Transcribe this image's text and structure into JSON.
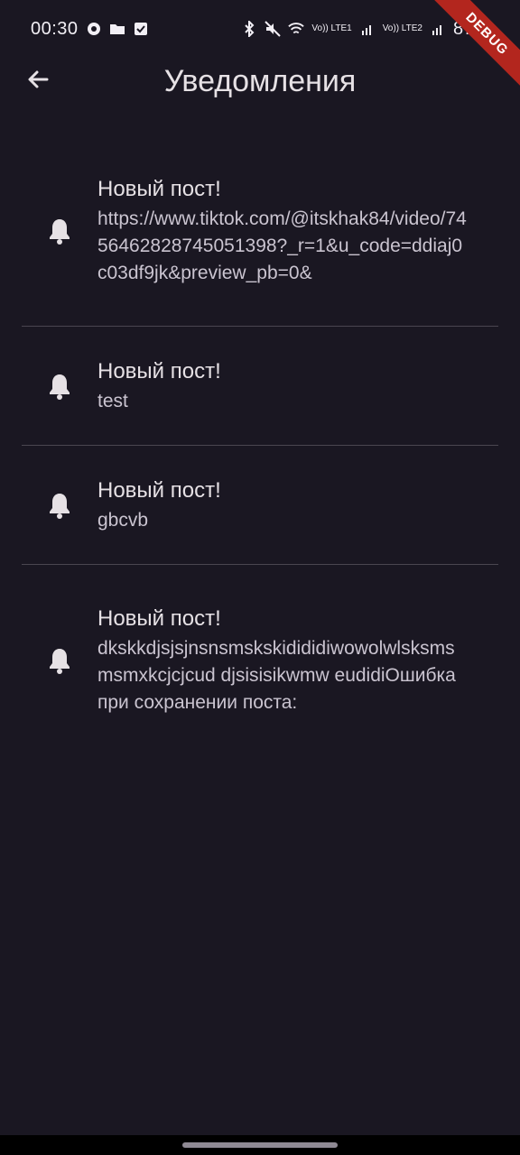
{
  "status_bar": {
    "time": "00:30",
    "signal_labels": [
      "Vo)) LTE1",
      "Vo)) LTE2"
    ],
    "battery": "87%"
  },
  "debug_ribbon": "DEBUG",
  "app_bar": {
    "title": "Уведомления"
  },
  "notifications": [
    {
      "title": "Новый пост!",
      "body": "https://www.tiktok.com/@itskhak84/video/7456462828745051398?_r=1&u_code=ddiaj0c03df9jk&preview_pb=0&"
    },
    {
      "title": "Новый пост!",
      "body": "test"
    },
    {
      "title": "Новый пост!",
      "body": "gbcvb"
    },
    {
      "title": "Новый пост!",
      "body": "dkskkdjsjsjnsnsmskskidididiwowolwlsksmsmsmxkcjcjcud djsisisikwmw eudidiОшибка при сохранении поста:"
    }
  ],
  "icons": {
    "back": "arrow-back-icon",
    "notification": "bell-icon"
  }
}
